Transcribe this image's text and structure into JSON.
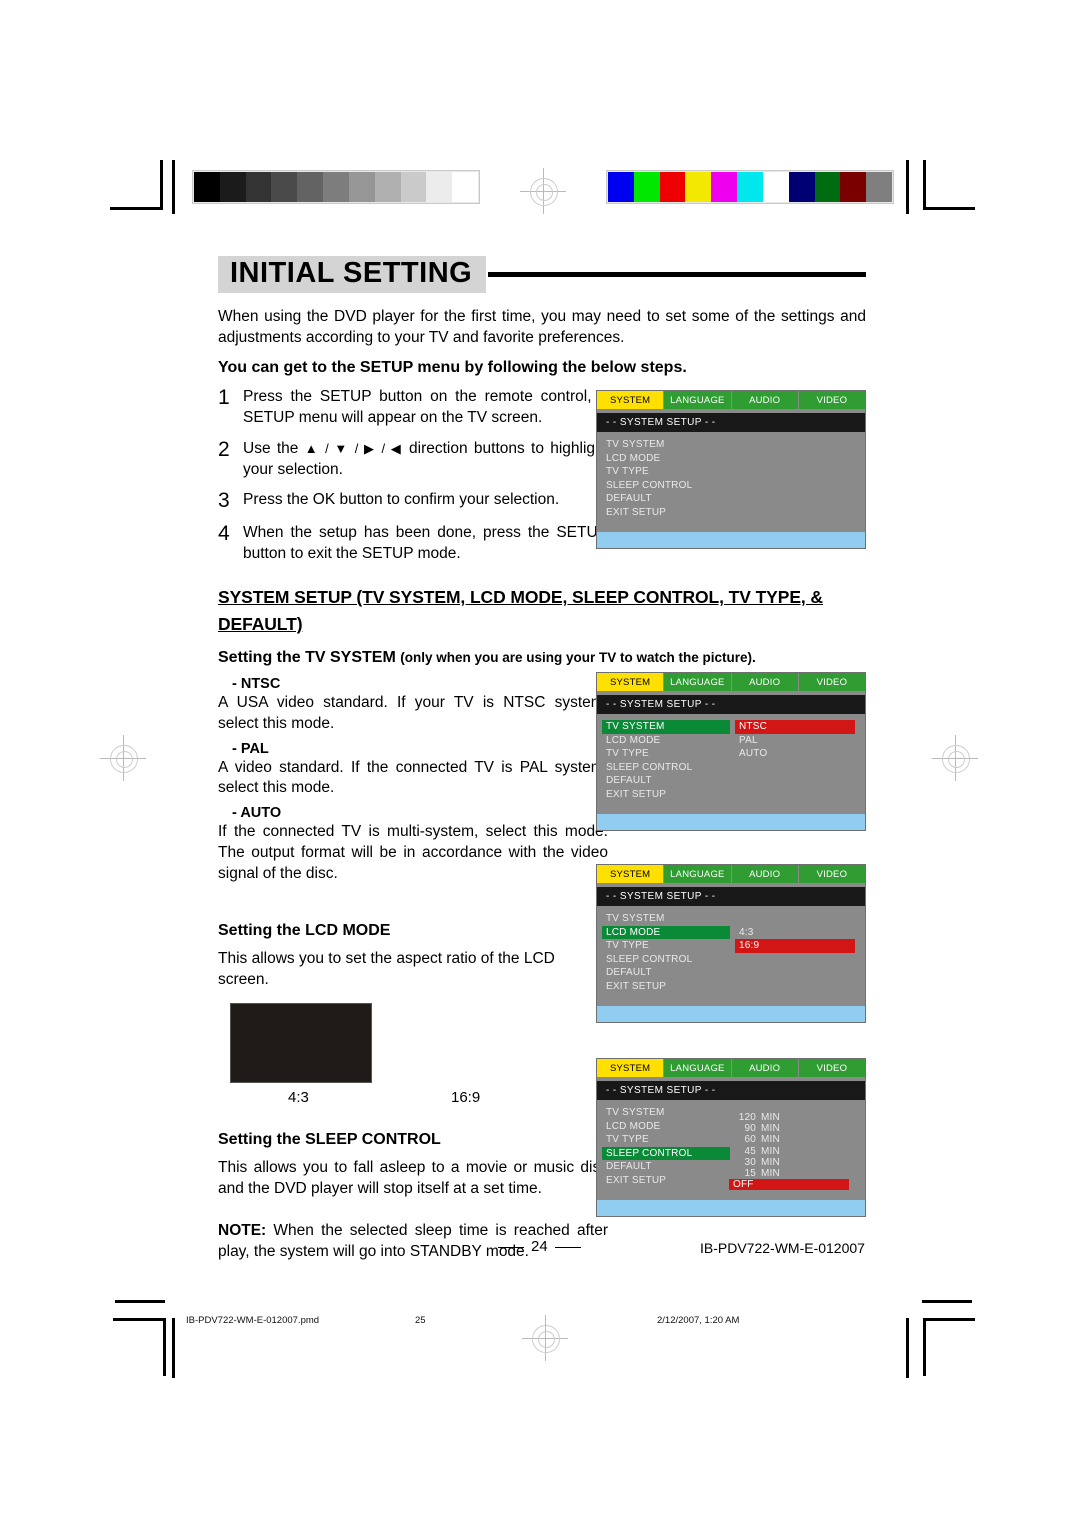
{
  "header": {
    "title": "INITIAL SETTING",
    "intro": "When using the DVD player for the first time, you may need to set some of the settings and adjustments according to your TV and favorite preferences.",
    "lead": "You can get to the SETUP menu by following the below steps."
  },
  "steps": [
    {
      "num": "1",
      "text": "Press the SETUP button on the remote control, a SETUP menu will appear on the TV screen."
    },
    {
      "num": "2",
      "pre": "Use the ",
      "arrows": "▲ / ▼ / ▶ / ◀",
      "post": " direction buttons to highlight your selection."
    },
    {
      "num": "3",
      "text": "Press the OK button to confirm your selection."
    },
    {
      "num": "4",
      "text": "When the setup has been done, press the SETUP button to exit the SETUP mode."
    }
  ],
  "section": {
    "heading": "SYSTEM SETUP (TV SYSTEM, LCD MODE, SLEEP CONTROL, TV TYPE, & DEFAULT)",
    "tv_system_title": "Setting the TV SYSTEM",
    "tv_system_note": "(only when you are using your TV to watch the picture).",
    "options": [
      {
        "label": "-  NTSC",
        "text": "A USA video standard. If your TV is NTSC system, select this mode."
      },
      {
        "label": "-  PAL",
        "text": "A video standard. If the connected TV is PAL system, select this mode."
      },
      {
        "label": "-  AUTO",
        "text": "If the connected TV is multi-system, select this mode. The output format will be in accordance with the video signal of the disc."
      }
    ],
    "lcd_title": "Setting the LCD MODE",
    "lcd_text": "This allows you to set the aspect ratio of the LCD screen.",
    "lcd_label_43": "4:3",
    "lcd_label_169": "16:9",
    "sleep_title": "Setting the SLEEP CONTROL",
    "sleep_text": "This allows you to fall asleep to a movie or music disc and the DVD player will stop itself at a set time.",
    "sleep_note_label": "NOTE:",
    "sleep_note_text": " When the selected sleep time is reached after play, the system will go into STANDBY mode."
  },
  "osd": {
    "tabs": [
      "SYSTEM",
      "LANGUAGE",
      "AUDIO",
      "VIDEO"
    ],
    "selected_tab": "SYSTEM",
    "header_text": "- -  SYSTEM SETUP   - -",
    "menu_items": [
      "TV SYSTEM",
      "LCD  MODE",
      "TV TYPE",
      "SLEEP CONTROL",
      "DEFAULT",
      "EXIT SETUP"
    ],
    "screens": [
      {
        "id": "setup-overview",
        "highlighted_item": null,
        "values": []
      },
      {
        "id": "tv-system",
        "highlighted_item": "TV SYSTEM",
        "values": [
          {
            "label": "NTSC",
            "selected": true
          },
          {
            "label": "PAL",
            "selected": false
          },
          {
            "label": "AUTO",
            "selected": false
          }
        ]
      },
      {
        "id": "lcd-mode",
        "highlighted_item": "LCD  MODE",
        "values": [
          {
            "label": "4:3",
            "selected": false
          },
          {
            "label": "16:9",
            "selected": true
          }
        ]
      },
      {
        "id": "sleep-control",
        "highlighted_item": "SLEEP CONTROL",
        "values": [
          {
            "num": "120",
            "unit": "MIN",
            "selected": false
          },
          {
            "num": "90",
            "unit": "MIN",
            "selected": false
          },
          {
            "num": "60",
            "unit": "MIN",
            "selected": false
          },
          {
            "num": "45",
            "unit": "MIN",
            "selected": false
          },
          {
            "num": "30",
            "unit": "MIN",
            "selected": false
          },
          {
            "num": "15",
            "unit": "MIN",
            "selected": false
          },
          {
            "num": "OFF",
            "unit": "",
            "selected": true
          }
        ]
      }
    ],
    "colors": {
      "tab_normal": "#2f9d32",
      "tab_selected": "#ffe000",
      "item_highlight": "#0a8a37",
      "value_highlight": "#d21616",
      "panel": "#8a8a8a",
      "header": "#181818",
      "footer": "#90cdf0"
    }
  },
  "footer": {
    "page_number": "24",
    "doc_code": "IB-PDV722-WM-E-012007",
    "print_file": "IB-PDV722-WM-E-012007.pmd",
    "print_page": "25",
    "print_time": "2/12/2007, 1:20 AM"
  },
  "calibration": {
    "gray_wedge": [
      "#000000",
      "#1b1b1b",
      "#333333",
      "#4a4a4a",
      "#636363",
      "#7d7d7d",
      "#969696",
      "#b0b0b0",
      "#cacaca",
      "#ececec",
      "#ffffff"
    ],
    "color_bar": [
      "#0000f0",
      "#00e800",
      "#ee0000",
      "#f2e800",
      "#ee00ee",
      "#00e8ee",
      "#ffffff",
      "#000072",
      "#006c12",
      "#7a0000",
      "#7f7f7f"
    ]
  }
}
